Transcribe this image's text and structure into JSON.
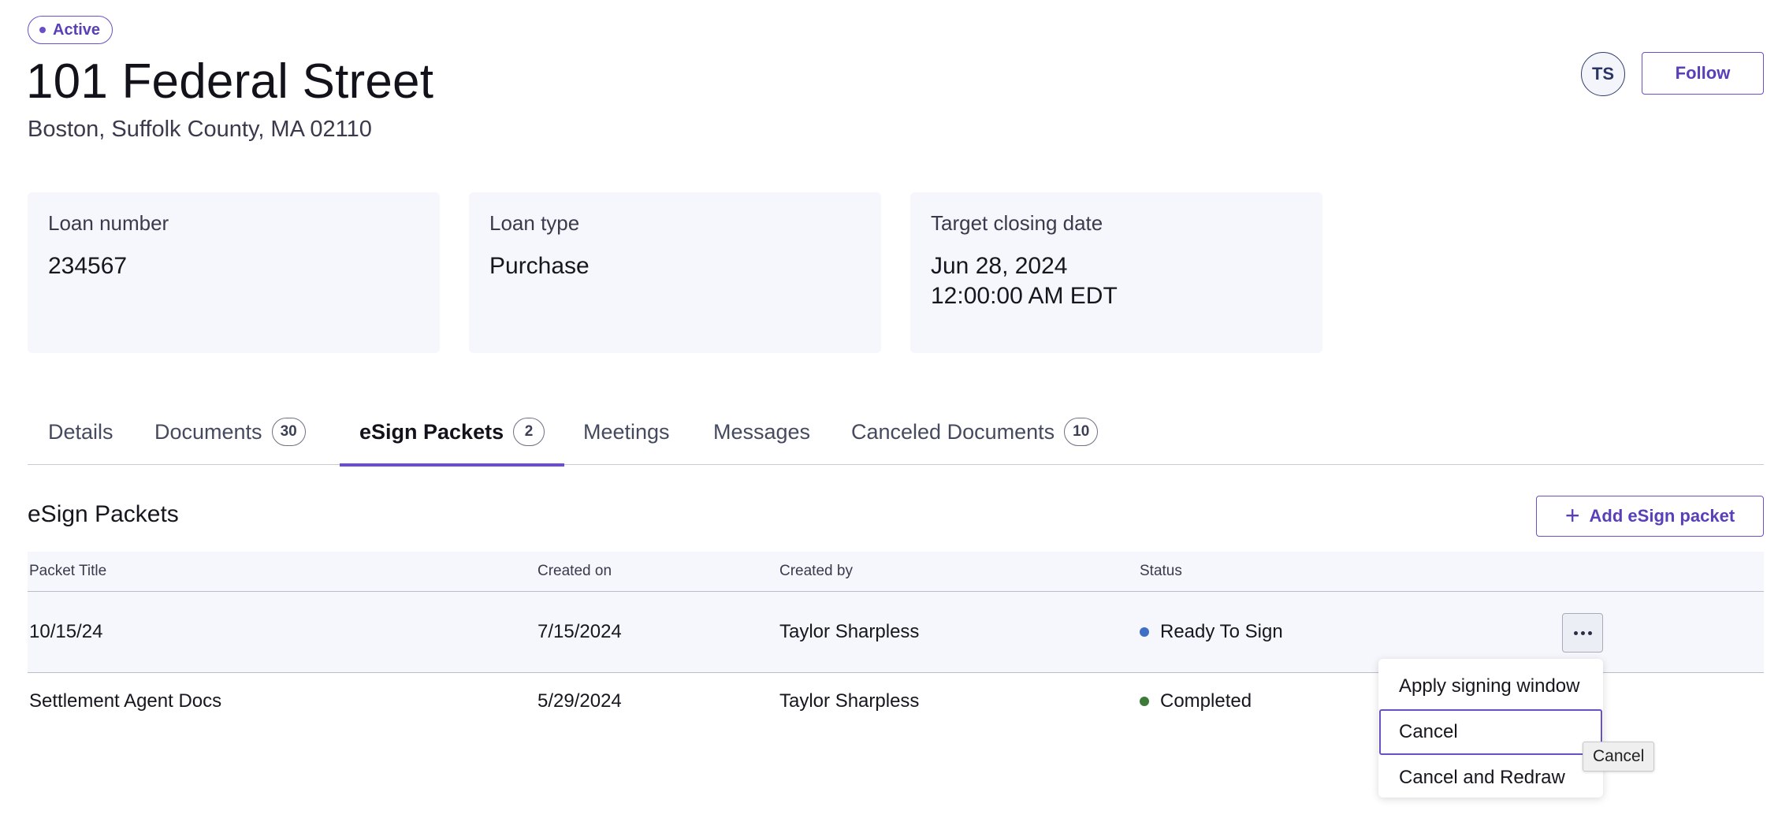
{
  "header": {
    "status_label": "Active",
    "title": "101 Federal Street",
    "address": "Boston, Suffolk County, MA 02110",
    "avatar_initials": "TS",
    "follow_label": "Follow"
  },
  "cards": [
    {
      "label": "Loan number",
      "value": "234567"
    },
    {
      "label": "Loan type",
      "value": "Purchase"
    },
    {
      "label": "Target closing date",
      "value": "Jun 28, 2024\n12:00:00 AM EDT"
    }
  ],
  "tabs": [
    {
      "label": "Details",
      "count": null
    },
    {
      "label": "Documents",
      "count": "30"
    },
    {
      "label": "eSign Packets",
      "count": "2",
      "active": true
    },
    {
      "label": "Meetings",
      "count": null
    },
    {
      "label": "Messages",
      "count": null
    },
    {
      "label": "Canceled Documents",
      "count": "10"
    }
  ],
  "section": {
    "title": "eSign Packets",
    "add_label": "Add eSign packet",
    "add_icon": "plus-icon"
  },
  "table": {
    "columns": [
      "Packet Title",
      "Created on",
      "Created by",
      "Status"
    ],
    "rows": [
      {
        "title": "10/15/24",
        "created_on": "7/15/2024",
        "created_by": "Taylor Sharpless",
        "status": "Ready To Sign",
        "status_color": "#3f6fc4"
      },
      {
        "title": "Settlement Agent Docs",
        "created_on": "5/29/2024",
        "created_by": "Taylor Sharpless",
        "status": "Completed",
        "status_color": "#3c7a3a"
      }
    ]
  },
  "row_menu": {
    "trigger_icon": "more-horizontal-icon",
    "items": [
      "Apply signing window",
      "Cancel",
      "Cancel and Redraw"
    ],
    "focused_index": 1,
    "tooltip": "Cancel"
  },
  "colors": {
    "accent": "#6a4fc9",
    "card_bg": "#f6f7fc"
  }
}
